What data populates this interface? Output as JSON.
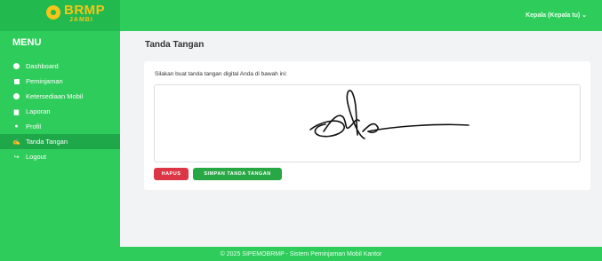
{
  "brand": {
    "name": "BRMP",
    "sub": "JAMBI"
  },
  "header": {
    "user": "Kepala (Kepala tu) ⌄"
  },
  "sidebar": {
    "title": "MENU",
    "items": [
      {
        "label": "Dashboard",
        "icon": "dashboard-icon"
      },
      {
        "label": "Peminjaman",
        "icon": "calendar-icon"
      },
      {
        "label": "Ketersediaan Mobil",
        "icon": "check-circle-icon"
      },
      {
        "label": "Laporan",
        "icon": "file-icon"
      },
      {
        "label": "Profil",
        "icon": "user-icon"
      },
      {
        "label": "Tanda Tangan",
        "icon": "signature-icon"
      },
      {
        "label": "Logout",
        "icon": "logout-icon"
      }
    ],
    "active_index": 5
  },
  "main": {
    "title": "Tanda Tangan",
    "instruction": "Silakan buat tanda tangan digital Anda di bawah ini:",
    "buttons": {
      "clear": "HAPUS",
      "save": "SIMPAN TANDA TANGAN"
    }
  },
  "footer": {
    "text": "© 2025 SIPEMOBRMP - Sistem Peminjaman Mobil Kantor"
  },
  "colors": {
    "primary": "#2ecc5a",
    "active": "#1fa849",
    "danger": "#dc3545",
    "success": "#28a745"
  }
}
